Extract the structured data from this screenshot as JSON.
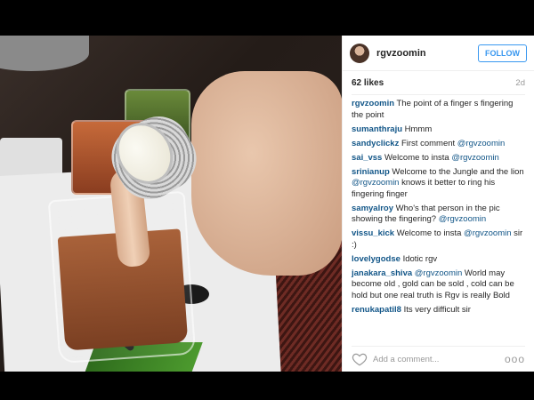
{
  "post": {
    "username": "rgvzoomin",
    "follow_label": "FOLLOW",
    "likes": "62 likes",
    "age": "2d",
    "add_comment_placeholder": "Add a comment...",
    "more_label": "ooo"
  },
  "comments": [
    {
      "user": "rgvzoomin",
      "text": "The point of a finger s fingering the point"
    },
    {
      "user": "sumanthraju",
      "text": "Hmmm"
    },
    {
      "user": "sandyclickz",
      "text": "First comment ",
      "mention": "@rgvzoomin"
    },
    {
      "user": "sai_vss",
      "text": "Welcome to insta ",
      "mention": "@rgvzoomin"
    },
    {
      "user": "srinianup",
      "text": "Welcome to the Jungle and the lion ",
      "mention": "@rgvzoomin",
      "after": " knows it better to ring his fingering finger"
    },
    {
      "user": "samyalroy",
      "text": "Who's that person in the pic showing the fingering? ",
      "mention": "@rgvzoomin"
    },
    {
      "user": "vissu_kick",
      "text": "Welcome to insta ",
      "mention": "@rgvzoomin",
      "after": " sir :)"
    },
    {
      "user": "lovelygodse",
      "text": "Idotic rgv"
    },
    {
      "user": "janakara_shiva",
      "text": "",
      "mention": "@rgvzoomin",
      "after": " World may become old , gold can be sold , cold can be hold but one real truth is Rgv is really Bold"
    },
    {
      "user": "renukapatil8",
      "text": "Its very difficult sir"
    }
  ],
  "colors": {
    "link": "#125688",
    "follow": "#3897f0",
    "muted": "#999999"
  },
  "icons": [
    "heart-icon",
    "more-icon"
  ]
}
